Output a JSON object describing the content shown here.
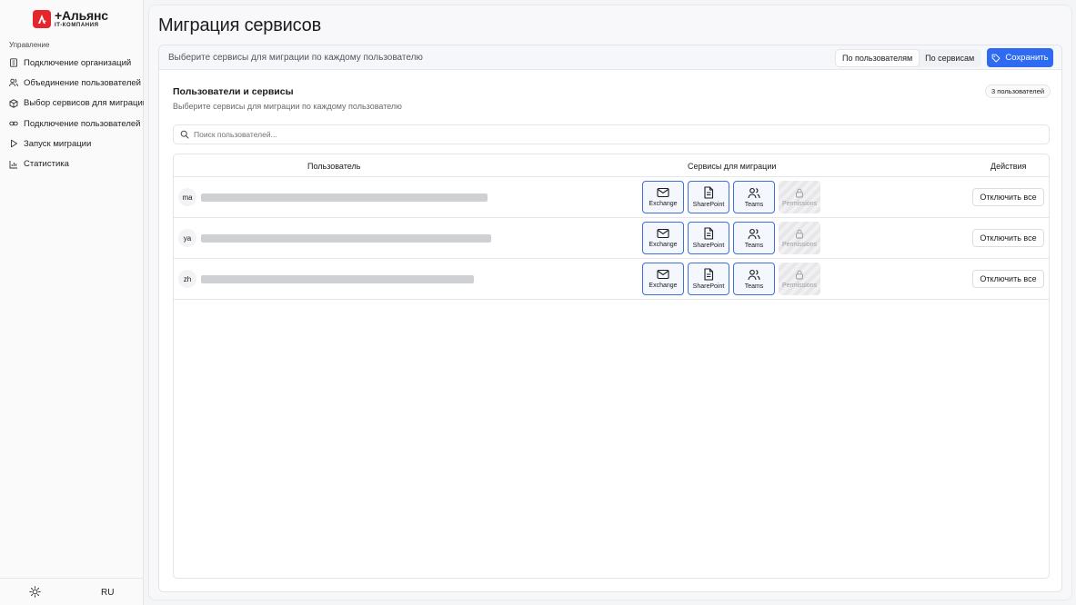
{
  "brand": {
    "name": "+Альянс",
    "subtitle": "IT-КОМПАНИЯ"
  },
  "sidebar": {
    "section_label": "Управление",
    "items": [
      {
        "label": "Подключение организаций",
        "icon": "building-icon"
      },
      {
        "label": "Объединение пользователей",
        "icon": "users-icon"
      },
      {
        "label": "Выбор сервисов для миграции",
        "icon": "package-icon"
      },
      {
        "label": "Подключение пользователей",
        "icon": "link-icon"
      },
      {
        "label": "Запуск миграции",
        "icon": "play-icon"
      },
      {
        "label": "Статистика",
        "icon": "chart-icon"
      }
    ],
    "footer": {
      "theme_icon": "sun-icon",
      "language": "RU"
    }
  },
  "page": {
    "title": "Миграция сервисов"
  },
  "card": {
    "header_hint": "Выберите сервисы для миграции по каждому пользователю",
    "view_toggle": {
      "options": [
        "По пользователям",
        "По сервисам"
      ],
      "selected": "По пользователям"
    },
    "save_label": "Сохранить",
    "section_title": "Пользователи и сервисы",
    "section_hint": "Выберите сервисы для миграции по каждому пользователю",
    "count_badge": "3 пользователей",
    "search_placeholder": "Поиск пользователей..."
  },
  "table": {
    "columns": {
      "user": "Пользователь",
      "services": "Сервисы для миграции",
      "actions": "Действия"
    },
    "rows": [
      {
        "initials": "ma",
        "action": "Отключить все"
      },
      {
        "initials": "ya",
        "action": "Отключить все"
      },
      {
        "initials": "zh",
        "action": "Отключить все"
      }
    ],
    "services": [
      {
        "label": "Exchange",
        "icon": "mail-icon",
        "selected": true
      },
      {
        "label": "SharePoint",
        "icon": "document-icon",
        "selected": true
      },
      {
        "label": "Teams",
        "icon": "users-icon",
        "selected": true
      },
      {
        "label": "Permissions",
        "icon": "lock-icon",
        "disabled": true
      }
    ]
  },
  "colors": {
    "accent": "#2f6bf0",
    "brand_red": "#e4262c",
    "selected_border": "#3f6fd8"
  }
}
